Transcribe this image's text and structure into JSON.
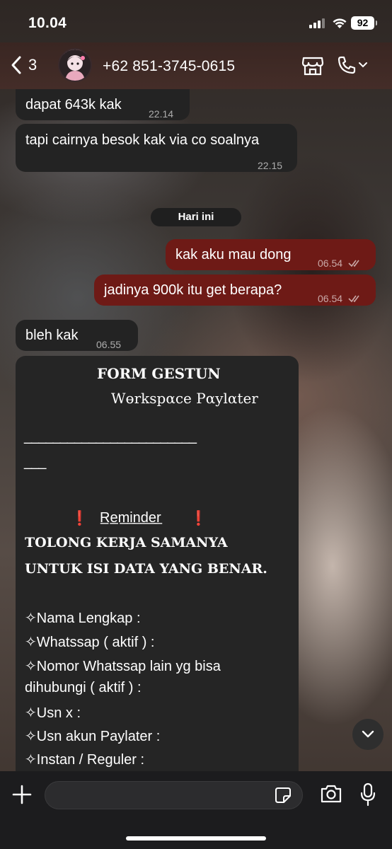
{
  "status_bar": {
    "time": "10.04",
    "battery": "92"
  },
  "header": {
    "back_count": "3",
    "contact": "+62 851-3745-0615"
  },
  "messages": [
    {
      "dir": "in",
      "text": "dapat 643k kak",
      "time": "22.14"
    },
    {
      "dir": "in",
      "text": "tapi cairnya besok kak via co soalnya",
      "time": "22.15"
    },
    {
      "dir": "out",
      "text": "kak aku mau dong",
      "time": "06.54"
    },
    {
      "dir": "out",
      "text": "jadinya 900k itu get berapa?",
      "time": "06.54"
    },
    {
      "dir": "in",
      "text": "bleh kak",
      "time": "06.55"
    }
  ],
  "date_separator": "Hari ini",
  "form": {
    "title": "FORM GESTUN",
    "subtitle": "Wөrkspαce Pαylαter",
    "divider_1": "________________________",
    "divider_2": "___",
    "reminder_mark": "❗",
    "reminder": "R̲e̲m̲i̲n̲d̲e̲r̲",
    "warning_1": "TOLONG KERJA SAMANYA",
    "warning_2": "UNTUK ISI DATA YANG BENAR.",
    "fields": [
      "✧Nama Lengkap :",
      "✧Whatssap ( aktif ) :",
      "✧Nomor Whatssap lain yg bisa",
      "dihubungi ( aktif ) :",
      "✧Usn x :",
      "✧Usn akun Paylater :",
      "✧Instan / Reguler :"
    ]
  },
  "input": {
    "placeholder": ""
  },
  "icons": {
    "back": "chevron-left-icon",
    "store": "store-icon",
    "call": "phone-icon",
    "plus": "plus-icon",
    "sticker": "sticker-icon",
    "camera": "camera-icon",
    "mic": "microphone-icon",
    "scroll": "chevron-down-icon"
  },
  "colors": {
    "incoming": "#232323",
    "outgoing": "#6e1a16",
    "accent_red": "#e0282b"
  }
}
